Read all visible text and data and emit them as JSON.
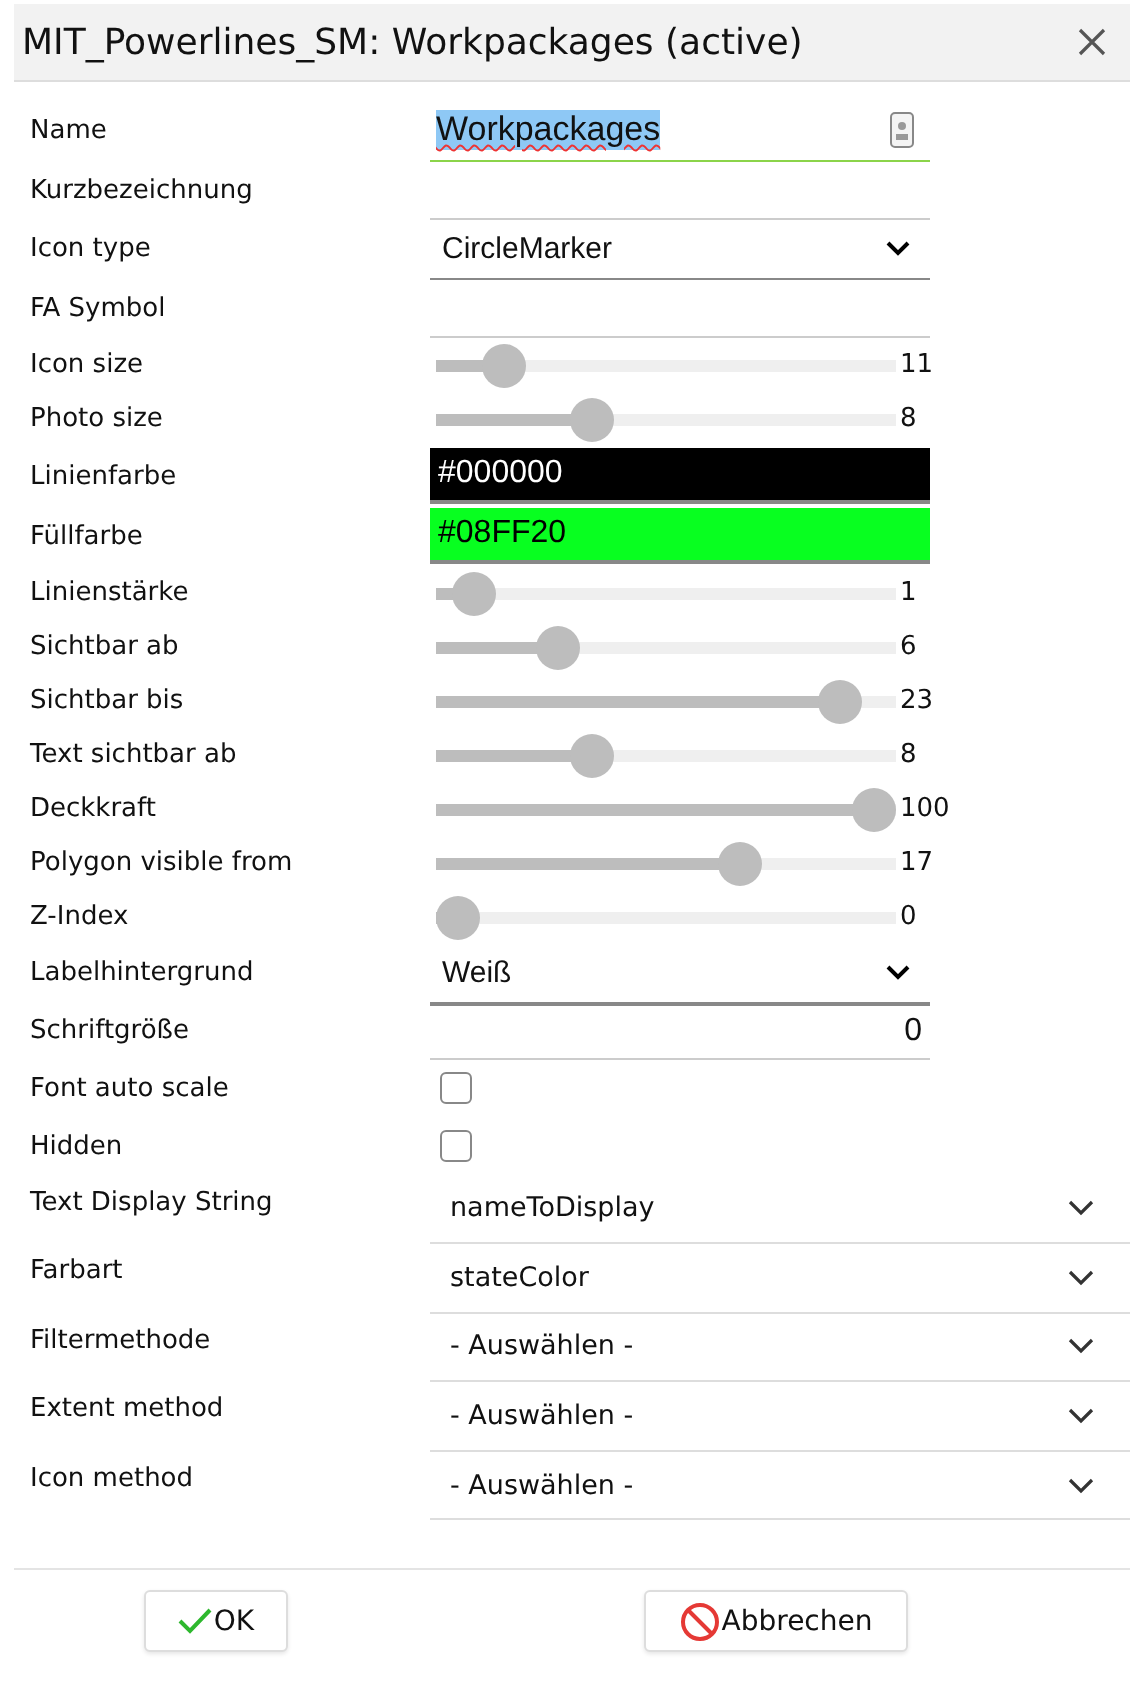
{
  "window": {
    "title": "MIT_Powerlines_SM: Workpackages (active)"
  },
  "fields": [
    {
      "kind": "text",
      "label": "Name",
      "value": "Workpackages",
      "highlighted": true,
      "focused": true
    },
    {
      "kind": "text",
      "label": "Kurzbezeichnung"
    },
    {
      "kind": "select",
      "label": "Icon type",
      "value": "CircleMarker"
    },
    {
      "kind": "text",
      "label": "FA Symbol"
    },
    {
      "kind": "slider",
      "label": "Icon size",
      "level": 0.11,
      "reading": "11"
    },
    {
      "kind": "slider",
      "label": "Photo size",
      "level": 0.32,
      "reading": "8"
    },
    {
      "kind": "color",
      "label": "Linienfarbe",
      "value": "#000000",
      "color": "#000000"
    },
    {
      "kind": "color",
      "label": "Füllfarbe",
      "value": "#08FF20",
      "color": "#08ff20"
    },
    {
      "kind": "slider",
      "label": "Linienstärke",
      "level": 0.04,
      "reading": "1"
    },
    {
      "kind": "slider",
      "label": "Sichtbar ab",
      "level": 0.24,
      "reading": "6"
    },
    {
      "kind": "slider",
      "label": "Sichtbar bis",
      "level": 0.92,
      "reading": "23"
    },
    {
      "kind": "slider",
      "label": "Text sichtbar ab",
      "level": 0.32,
      "reading": "8"
    },
    {
      "kind": "slider",
      "label": "Deckkraft",
      "level": 1,
      "reading": "100"
    },
    {
      "kind": "slider",
      "label": "Polygon visible from",
      "level": 0.68,
      "reading": "17"
    },
    {
      "kind": "slider",
      "label": "Z-Index",
      "level": 0,
      "reading": "0"
    },
    {
      "kind": "select",
      "label": "Labelhintergrund",
      "value": "Weiß"
    },
    {
      "kind": "number",
      "label": "Schriftgröße",
      "value": "0"
    },
    {
      "kind": "checkbox",
      "label": "Font auto scale",
      "checked": false
    },
    {
      "kind": "checkbox",
      "label": "Hidden",
      "checked": false
    },
    {
      "kind": "wide-select",
      "label": "Text Display String",
      "value": "nameToDisplay"
    },
    {
      "kind": "wide-select",
      "label": "Farbart",
      "value": "stateColor"
    },
    {
      "kind": "wide-select",
      "label": "Filtermethode",
      "value": "- Auswählen -"
    },
    {
      "kind": "wide-select",
      "label": "Extent method",
      "value": "- Auswählen -"
    },
    {
      "kind": "wide-select",
      "label": "Icon method",
      "value": "- Auswählen -"
    }
  ],
  "buttons": [
    {
      "kind": "ok",
      "label": "OK"
    },
    {
      "kind": "cancel",
      "label": "Abbrechen"
    }
  ]
}
